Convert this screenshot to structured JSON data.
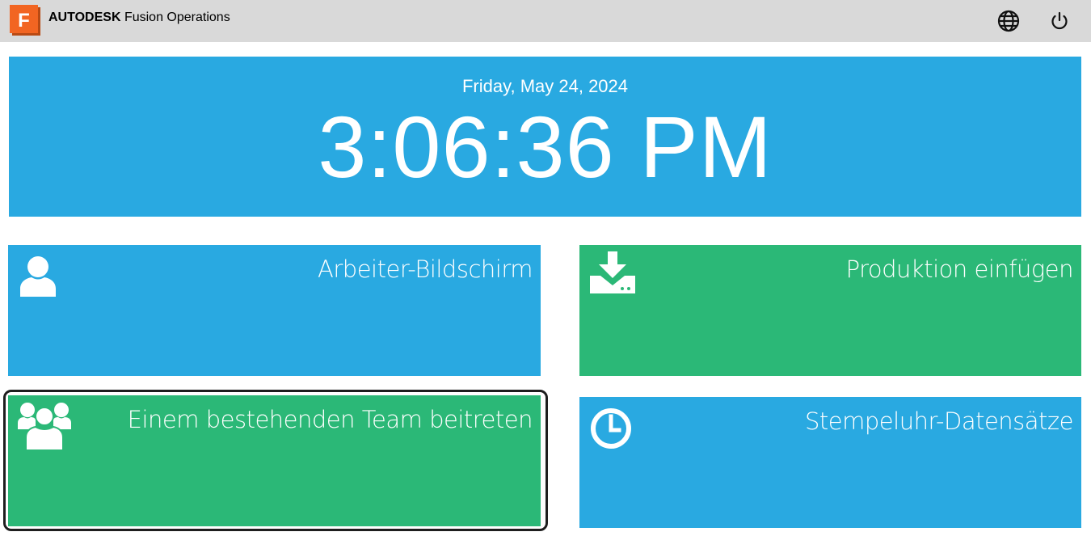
{
  "header": {
    "logo_letter": "F",
    "brand_company": "AUTODESK",
    "brand_product": "Fusion Operations",
    "language_icon": "globe-icon",
    "power_icon": "power-icon"
  },
  "clock": {
    "date": "Friday, May 24, 2024",
    "time": "3:06:36 PM"
  },
  "tiles": [
    {
      "label": "Arbeiter-Bildschirm",
      "icon": "user-icon",
      "color": "#29a9e1"
    },
    {
      "label": "Produktion einfügen",
      "icon": "download-tray-icon",
      "color": "#2bb877"
    },
    {
      "label": "Einem bestehenden Team beitreten",
      "icon": "team-icon",
      "color": "#2bb877",
      "focused": true
    },
    {
      "label": "Stempeluhr-Datensätze",
      "icon": "clock-icon",
      "color": "#29a9e1"
    }
  ],
  "colors": {
    "header_bg": "#d9d9d9",
    "blue": "#29a9e1",
    "green": "#2bb877",
    "logo_orange": "#f26522"
  }
}
